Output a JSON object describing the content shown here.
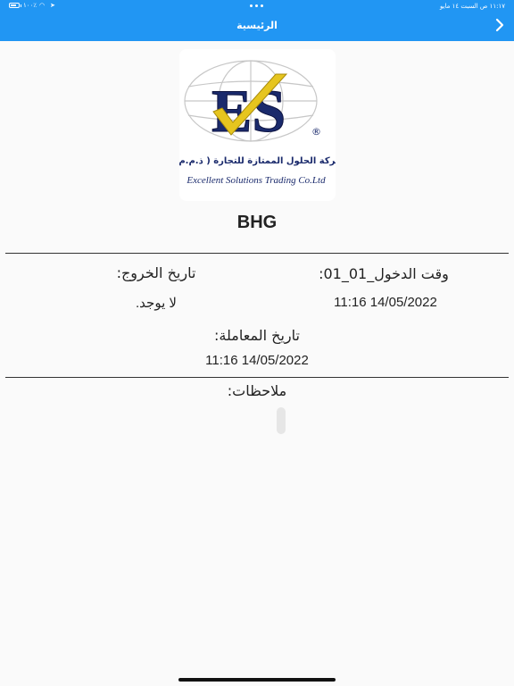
{
  "status_bar": {
    "time_text": "١١:١٧ ص   السبت ١٤ مايو",
    "battery_level": 0.8,
    "battery_text": "١٠٠٪"
  },
  "header": {
    "title": "الرئيسية",
    "back_icon": "chevron-right-icon",
    "background_color": "#2196f3"
  },
  "logo": {
    "mark_text": "ES",
    "registered_text": "®",
    "arabic_text": "شركة الحلول الممتازة للتجارة ( ذ.م.م )",
    "english_text": "Excellent Solutions Trading Co.Ltd"
  },
  "record": {
    "title": "BHG",
    "entry_label": "وقت الدخول_01_01:",
    "entry_value": "11:16 14/05/2022",
    "exit_label": "تاريخ الخروج:",
    "exit_value": "لا يوجد.",
    "transaction_label": "تاريخ المعاملة:",
    "transaction_value": "11:16 14/05/2022",
    "notes_label": "ملاحظات:"
  }
}
